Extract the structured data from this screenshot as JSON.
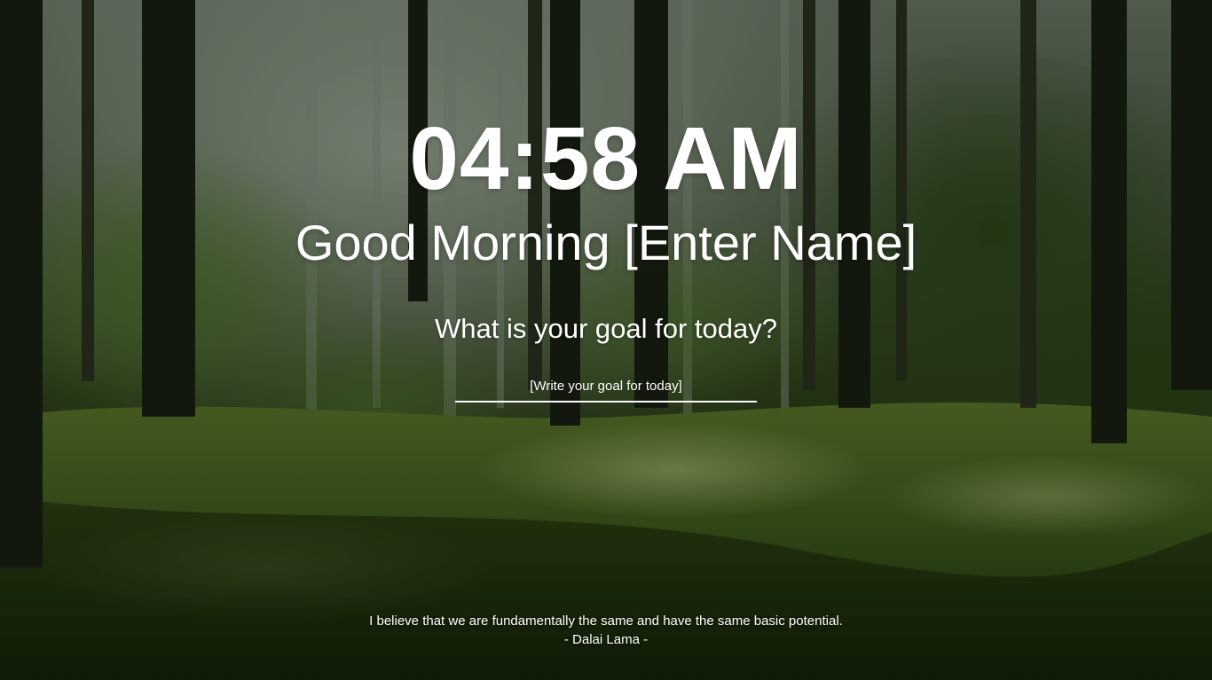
{
  "clock": {
    "time": "04:58 AM"
  },
  "greeting": {
    "text": "Good Morning [Enter Name]"
  },
  "goal": {
    "question": "What is your goal for today?",
    "placeholder": "[Write your goal for today]",
    "value": ""
  },
  "quote": {
    "text": "I believe that we are fundamentally the same and have the same basic potential.",
    "author": "- Dalai Lama -"
  },
  "background": {
    "scene": "forest-photo",
    "colors": {
      "sky_haze": "#8fa08a",
      "foliage": "#3c5a22",
      "grass_light": "#6f8d3a",
      "trunk": "#1c2416"
    }
  }
}
